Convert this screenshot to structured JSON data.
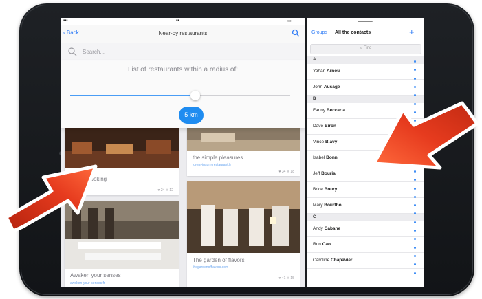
{
  "left_app": {
    "nav": {
      "back": "Back",
      "title": "Near-by restaurants"
    },
    "search": {
      "placeholder": "Search..."
    },
    "radius": {
      "caption": "List of restaurants within a radius of:",
      "value": "5 km",
      "slider_fraction": 0.57
    },
    "cards": [
      {
        "title": "Mary's cooking",
        "link": "",
        "stats": "♥ 24   ✉ 12"
      },
      {
        "title": "the simple pleasures",
        "link": "lorem-ipsum-restaurant.fr",
        "stats": "♥ 34   ✉ 18"
      },
      {
        "title": "Awaken your senses",
        "link": "awaken-your-senses.fr",
        "stats": ""
      },
      {
        "title": "The garden of flavors",
        "link": "thegardenofflavors.com",
        "stats": "♥ 41   ✉ 15"
      }
    ]
  },
  "right_app": {
    "nav": {
      "groups": "Groups",
      "title": "All the contacts",
      "add": "+"
    },
    "find_placeholder": "Find",
    "sections": [
      {
        "letter": "A",
        "contacts": [
          {
            "first": "Yohan",
            "last": "Arnou"
          },
          {
            "first": "John",
            "last": "Ausage"
          }
        ]
      },
      {
        "letter": "B",
        "contacts": [
          {
            "first": "Fanny",
            "last": "Beccaria"
          },
          {
            "first": "Dave",
            "last": "Biron"
          },
          {
            "first": "Vince",
            "last": "Blavy"
          },
          {
            "first": "Isabel",
            "last": "Bonn"
          },
          {
            "first": "Jeff",
            "last": "Bouria"
          },
          {
            "first": "Brice",
            "last": "Boury"
          },
          {
            "first": "Mary",
            "last": "Bourtho"
          }
        ]
      },
      {
        "letter": "C",
        "contacts": [
          {
            "first": "Andy",
            "last": "Cabane"
          },
          {
            "first": "Ron",
            "last": "Cao"
          },
          {
            "first": "Caroline",
            "last": "Chapavier"
          }
        ]
      }
    ]
  },
  "colors": {
    "accent": "#2f7cf6",
    "bubble": "#1f8cf0",
    "arrow": "#e63b1e"
  }
}
